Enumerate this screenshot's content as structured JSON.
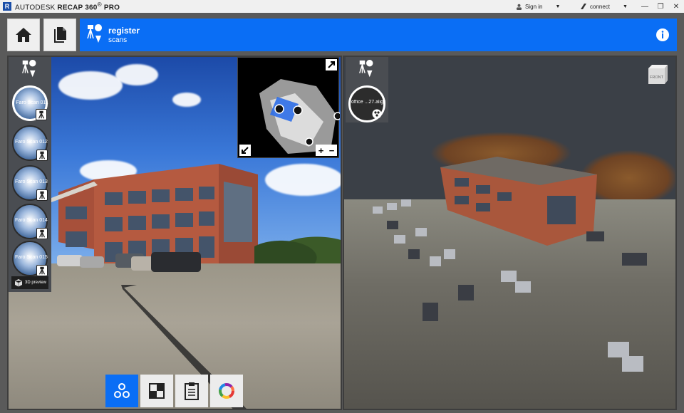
{
  "titlebar": {
    "brand": "AUTODESK",
    "product": "RECAP 360",
    "edition": "PRO",
    "user_label": "Sign in",
    "connect_label": "connect",
    "window_controls": [
      "minimize",
      "maximize",
      "close"
    ]
  },
  "header": {
    "title": "register",
    "subtitle": "scans"
  },
  "left_panel": {
    "scans": [
      {
        "label": "Faro Scan 011",
        "selected": true
      },
      {
        "label": "Faro Scan 012",
        "selected": false
      },
      {
        "label": "Faro Scan 013",
        "selected": false
      },
      {
        "label": "Faro Scan 014",
        "selected": false
      },
      {
        "label": "Faro Scan 015",
        "selected": false
      }
    ],
    "preview_label": "3D preview"
  },
  "right_panel": {
    "align_scan_label": "office ...27.align",
    "view_cube_label": "FRONT"
  },
  "bottom_tools": [
    "targets",
    "checkerboard",
    "clipboard",
    "color"
  ],
  "colors": {
    "accent": "#0a6ef5",
    "titlebar_bg": "#f0f0f0",
    "app_bg": "#5a5a5a"
  }
}
